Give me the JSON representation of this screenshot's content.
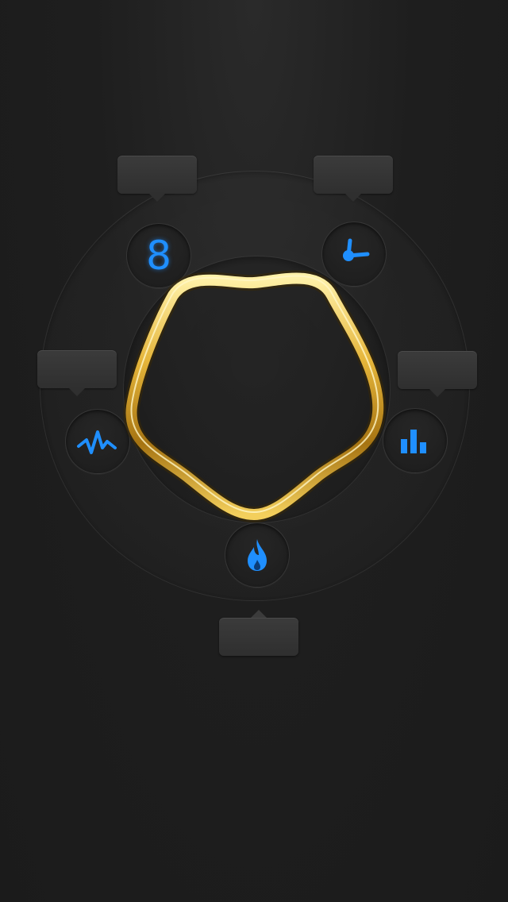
{
  "score_digit": "8",
  "center_mark": "",
  "bubbles": {
    "top_left": "",
    "top_right": "",
    "left": "",
    "right": "",
    "bottom": ""
  },
  "colors": {
    "accent": "#1f8fff",
    "ring": "#d9a628",
    "background": "#1e1e1e"
  },
  "nodes": [
    {
      "name": "level-node",
      "icon": "digit-eight-icon"
    },
    {
      "name": "timer-node",
      "icon": "clock-hand-icon"
    },
    {
      "name": "stats-node",
      "icon": "bar-chart-icon"
    },
    {
      "name": "heat-node",
      "icon": "flame-icon"
    },
    {
      "name": "pulse-node",
      "icon": "pulse-wave-icon"
    }
  ]
}
